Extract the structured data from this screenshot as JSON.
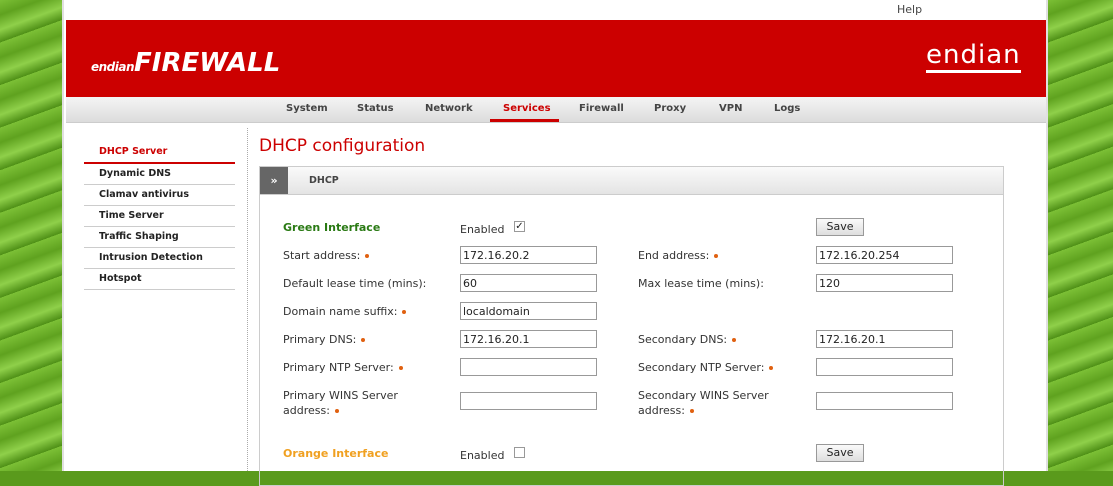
{
  "header": {
    "help_label": "Help",
    "logo_small": "endian",
    "logo_big": "FIREWALL",
    "brand_right": "endian"
  },
  "nav": {
    "items": [
      "System",
      "Status",
      "Network",
      "Services",
      "Firewall",
      "Proxy",
      "VPN",
      "Logs"
    ],
    "active": "Services"
  },
  "sidebar": {
    "items": [
      "DHCP Server",
      "Dynamic DNS",
      "Clamav antivirus",
      "Time Server",
      "Traffic Shaping",
      "Intrusion Detection",
      "Hotspot"
    ],
    "active": "DHCP Server"
  },
  "page_title": "DHCP configuration",
  "panel": {
    "toggle": "»",
    "title": "DHCP"
  },
  "green": {
    "title": "Green Interface",
    "enabled_label": "Enabled",
    "enabled_checked": true,
    "checkbox_mark": "✓",
    "save_label": "Save",
    "start_label": "Start address:",
    "start_value": "172.16.20.2",
    "end_label": "End address:",
    "end_value": "172.16.20.254",
    "default_lease_label": "Default lease time (mins):",
    "default_lease_value": "60",
    "max_lease_label": "Max lease time (mins):",
    "max_lease_value": "120",
    "domain_label": "Domain name suffix:",
    "domain_value": "localdomain",
    "primary_dns_label": "Primary DNS:",
    "primary_dns_value": "172.16.20.1",
    "secondary_dns_label": "Secondary DNS:",
    "secondary_dns_value": "172.16.20.1",
    "primary_ntp_label": "Primary NTP Server:",
    "primary_ntp_value": "",
    "secondary_ntp_label": "Secondary NTP Server:",
    "secondary_ntp_value": "",
    "primary_wins_label_1": "Primary WINS Server",
    "primary_wins_label_2": "address:",
    "primary_wins_value": "",
    "secondary_wins_label_1": "Secondary WINS Server",
    "secondary_wins_label_2": "address:",
    "secondary_wins_value": ""
  },
  "orange": {
    "title": "Orange Interface",
    "enabled_label": "Enabled",
    "enabled_checked": false,
    "save_label": "Save"
  },
  "colors": {
    "brand_red": "#cc0000",
    "green_title": "#2a7a14",
    "orange_title": "#f0a020"
  }
}
